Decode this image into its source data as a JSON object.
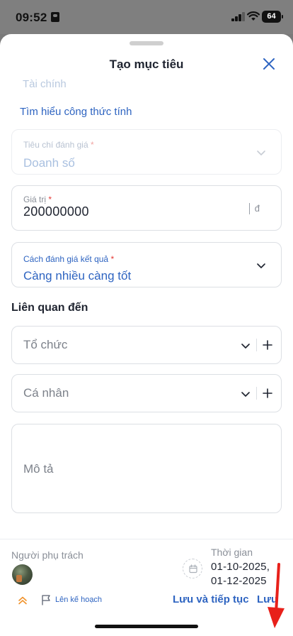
{
  "status_bar": {
    "time": "09:52",
    "battery": "64"
  },
  "sheet": {
    "title": "Tạo mục tiêu"
  },
  "form": {
    "faded_above": "Tài chính",
    "learn_link": "Tìm hiểu công thức tính",
    "criteria": {
      "label": "Tiêu chí đánh giá",
      "value": "Doanh số"
    },
    "goal_value": {
      "label": "Giá trị",
      "value": "200000000",
      "unit": "đ"
    },
    "method": {
      "label": "Cách đánh giá kết quả",
      "value": "Càng nhiều càng tốt"
    },
    "related_title": "Liên quan đến",
    "organization_placeholder": "Tổ chức",
    "person_placeholder": "Cá nhân",
    "description_placeholder": "Mô tả"
  },
  "footer": {
    "owner_label": "Người phụ trách",
    "time_label": "Thời gian",
    "time_line1": "01-10-2025,",
    "time_line2": "01-12-2025",
    "plan_label": "Lên kế hoạch",
    "save_continue": "Lưu và tiếp tục",
    "save": "Lưu"
  },
  "colors": {
    "accent": "#2e64c1",
    "required": "#e53935",
    "annotation_arrow": "#e8201a"
  },
  "icons": [
    "id-card-icon",
    "signal-icon",
    "wifi-icon",
    "battery-icon",
    "close-icon",
    "chevron-down-icon",
    "plus-icon",
    "calendar-icon",
    "priority-chevrons-icon",
    "flag-icon",
    "arrow-annotation"
  ]
}
